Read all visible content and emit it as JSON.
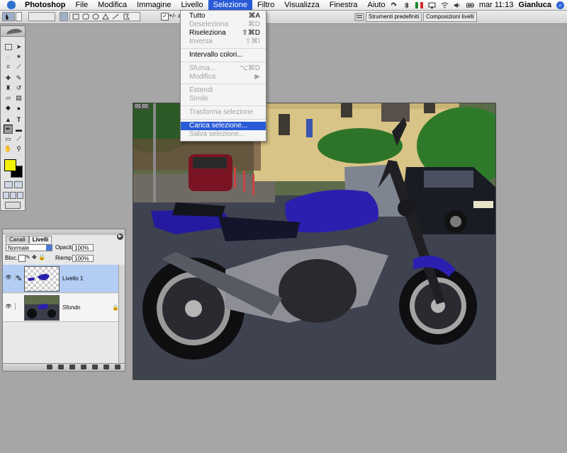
{
  "menubar": {
    "app_name": "Photoshop",
    "items": [
      "File",
      "Modifica",
      "Immagine",
      "Livello",
      "Selezione",
      "Filtro",
      "Visualizza",
      "Finestra",
      "Aiuto"
    ],
    "active_item": "Selezione",
    "clock": "mar 11:13",
    "user": "Gianluca"
  },
  "options_bar": {
    "antialias_label": "+/- au",
    "palette_well": [
      "Strumenti predefiniti",
      "Composizioni livelli"
    ]
  },
  "selezione_menu": [
    {
      "label": "Tutto",
      "shortcut": "⌘A",
      "enabled": true
    },
    {
      "label": "Deseleziona",
      "shortcut": "⌘D",
      "enabled": false
    },
    {
      "label": "Riseleziona",
      "shortcut": "⇧⌘D",
      "enabled": true
    },
    {
      "label": "Inversa",
      "shortcut": "⇧⌘I",
      "enabled": false
    },
    {
      "label": "Intervallo colori...",
      "shortcut": "",
      "enabled": true
    },
    {
      "label": "Sfuma...",
      "shortcut": "⌥⌘D",
      "enabled": false
    },
    {
      "label": "Modifica",
      "shortcut": "▶",
      "enabled": false
    },
    {
      "label": "Estendi",
      "shortcut": "",
      "enabled": false
    },
    {
      "label": "Simile",
      "shortcut": "",
      "enabled": false
    },
    {
      "label": "Trasforma selezione",
      "shortcut": "",
      "enabled": false
    },
    {
      "label": "Carica selezione...",
      "shortcut": "",
      "enabled": true,
      "highlighted": true
    },
    {
      "label": "Salva selezione...",
      "shortcut": "",
      "enabled": false
    }
  ],
  "toolbox": {
    "foreground_color": "#f2f200",
    "background_color": "#000000"
  },
  "document": {
    "zoom_label": "01 02"
  },
  "layers_palette": {
    "tabs": [
      "Canali",
      "Livelli"
    ],
    "active_tab": "Livelli",
    "blend_mode": "Normale",
    "opacity_label": "Opacità:",
    "opacity_value": "100%",
    "lock_label": "Bloc.:",
    "fill_label": "Riemp.:",
    "fill_value": "100%",
    "layers": [
      {
        "name": "Livello 1",
        "selected": true,
        "italic": false,
        "locked": false
      },
      {
        "name": "Sfondo",
        "selected": false,
        "italic": true,
        "locked": true
      }
    ]
  }
}
